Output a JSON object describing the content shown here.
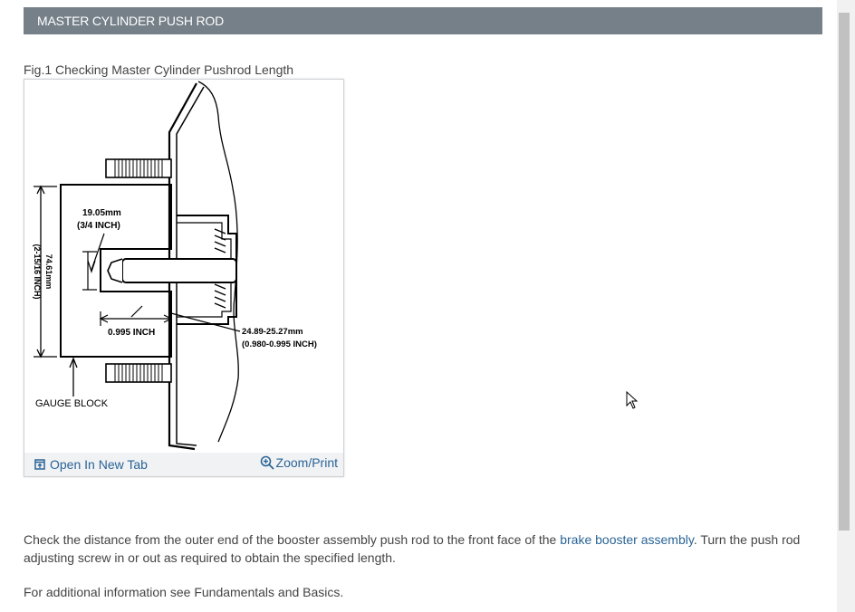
{
  "header": {
    "title": "MASTER CYLINDER PUSH ROD"
  },
  "figure": {
    "caption": "Fig.1 Checking Master Cylinder Pushrod Length",
    "labels": {
      "dim_top_mm": "19.05mm",
      "dim_top_in": "(3/4 INCH)",
      "dim_left_mm": "74.61mm",
      "dim_left_in": "(2-15/16 INCH)",
      "dim_gap": "0.995 INCH",
      "dim_right_mm": "24.89-25.27mm",
      "dim_right_in": "(0.980-0.995 INCH)",
      "gauge_block": "GAUGE BLOCK"
    },
    "open_label": "Open In New Tab",
    "zoom_label": "Zoom/Print",
    "open_icon": "open-new-tab-icon",
    "zoom_icon": "magnifier-plus-icon"
  },
  "content": {
    "para1_before": "Check the distance from the outer end of the booster assembly push rod to the front face of the ",
    "para1_link": "brake booster assembly",
    "para1_after": ". Turn the push rod adjusting screw in or out as required to obtain the specified length.",
    "para2": "For additional information see Fundamentals and Basics."
  }
}
